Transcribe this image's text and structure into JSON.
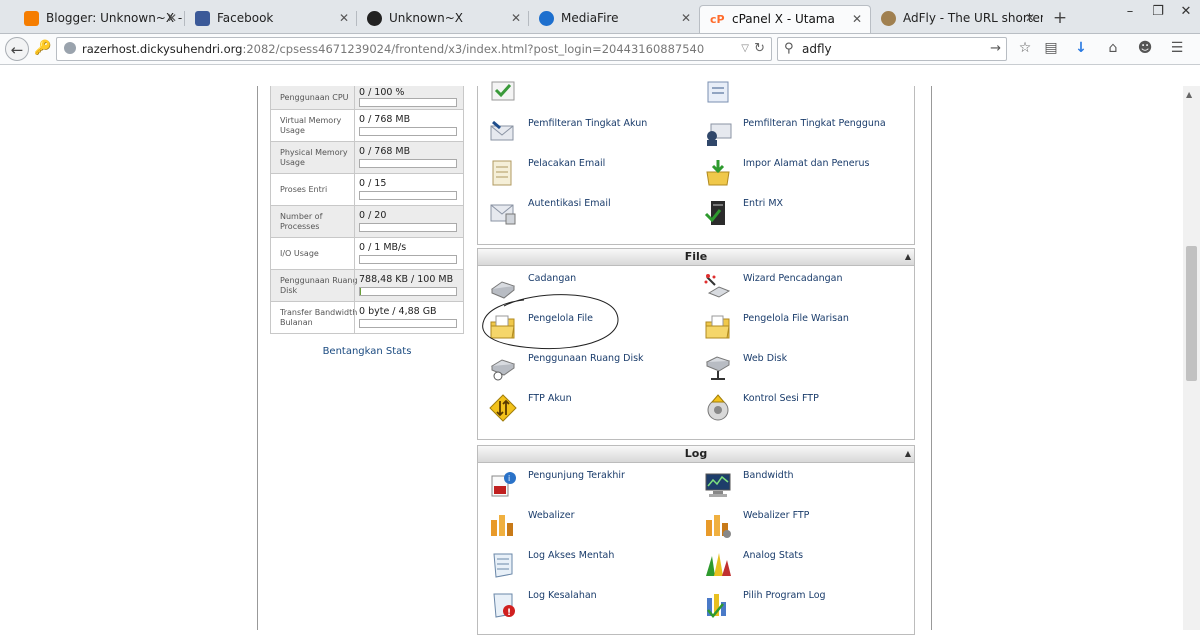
{
  "browser": {
    "tabs": [
      {
        "label": "Blogger: Unknown~X - ...",
        "favicon": "blogger-icon",
        "color": "#f57d00",
        "active": false
      },
      {
        "label": "Facebook",
        "favicon": "facebook-icon",
        "color": "#3b5998",
        "active": false
      },
      {
        "label": "Unknown~X",
        "favicon": "blog-logo-icon",
        "color": "#222222",
        "active": false
      },
      {
        "label": "MediaFire",
        "favicon": "mediafire-icon",
        "color": "#1d6fce",
        "active": false
      },
      {
        "label": "cPanel X - Utama",
        "favicon": "cpanel-icon",
        "color": "#ff6c2c",
        "active": true
      },
      {
        "label": "AdFly - The URL shorten...",
        "favicon": "adfly-icon",
        "color": "#a08050",
        "active": false
      }
    ],
    "new_tab": "+",
    "window_controls": {
      "minimize": "–",
      "restore": "❐",
      "close": "✕"
    },
    "url": {
      "host": "razerhost.dickysuhendri.org",
      "rest": ":2082/cpsess4671239024/frontend/x3/index.html?post_login=20443160887540"
    },
    "search": {
      "value": "adfly"
    },
    "toolbar_icons": [
      "bookmark-star-icon",
      "reading-list-icon",
      "download-icon",
      "home-icon",
      "chat-icon",
      "menu-icon"
    ]
  },
  "stats": {
    "rows": [
      {
        "label": "Penggunaan CPU",
        "value": "0 / 100 %",
        "fraction": 0
      },
      {
        "label": "Virtual Memory Usage",
        "value": "0 / 768 MB",
        "fraction": 0
      },
      {
        "label": "Physical Memory Usage",
        "value": "0 / 768 MB",
        "fraction": 0
      },
      {
        "label": "Proses Entri",
        "value": "0 / 15",
        "fraction": 0
      },
      {
        "label": "Number of Processes",
        "value": "0 / 20",
        "fraction": 0
      },
      {
        "label": "I/O Usage",
        "value": "0 / 1 MB/s",
        "fraction": 0
      },
      {
        "label": "Penggunaan Ruang Disk",
        "value": "788,48 KB / 100 MB",
        "fraction": 0.008
      },
      {
        "label": "Transfer Bandwidth Bulanan",
        "value": "0 byte / 4,88 GB",
        "fraction": 0
      }
    ],
    "expand_link": "Bentangkan Stats"
  },
  "email_panel": {
    "items": [
      {
        "label": "",
        "icon": "checkmark-box-icon"
      },
      {
        "label": "",
        "icon": "list-icon"
      },
      {
        "label": "Pemfilteran Tingkat Akun",
        "icon": "mail-filter-icon"
      },
      {
        "label": "Pemfilteran Tingkat Pengguna",
        "icon": "user-filter-icon"
      },
      {
        "label": "Pelacakan Email",
        "icon": "email-trace-icon"
      },
      {
        "label": "Impor Alamat dan Penerus",
        "icon": "import-icon"
      },
      {
        "label": "Autentikasi Email",
        "icon": "email-auth-icon"
      },
      {
        "label": "Entri MX",
        "icon": "mx-server-icon"
      }
    ]
  },
  "file_panel": {
    "title": "File",
    "items": [
      {
        "label": "Cadangan",
        "icon": "backup-drive-icon"
      },
      {
        "label": "Wizard Pencadangan",
        "icon": "backup-wizard-icon"
      },
      {
        "label": "Pengelola File",
        "icon": "folder-icon"
      },
      {
        "label": "Pengelola File Warisan",
        "icon": "legacy-folder-icon"
      },
      {
        "label": "Penggunaan Ruang Disk",
        "icon": "disk-usage-icon"
      },
      {
        "label": "Web Disk",
        "icon": "web-disk-icon"
      },
      {
        "label": "FTP Akun",
        "icon": "ftp-icon"
      },
      {
        "label": "Kontrol Sesi FTP",
        "icon": "ftp-session-icon"
      }
    ]
  },
  "log_panel": {
    "title": "Log",
    "items": [
      {
        "label": "Pengunjung Terakhir",
        "icon": "visitors-icon"
      },
      {
        "label": "Bandwidth",
        "icon": "bandwidth-monitor-icon"
      },
      {
        "label": "Webalizer",
        "icon": "webalizer-icon"
      },
      {
        "label": "Webalizer FTP",
        "icon": "webalizer-ftp-icon"
      },
      {
        "label": "Log Akses Mentah",
        "icon": "raw-log-icon"
      },
      {
        "label": "Analog Stats",
        "icon": "analog-stats-icon"
      },
      {
        "label": "Log Kesalahan",
        "icon": "error-log-icon"
      },
      {
        "label": "Pilih Program Log",
        "icon": "log-program-icon"
      }
    ]
  },
  "collapse_glyph": "▲"
}
